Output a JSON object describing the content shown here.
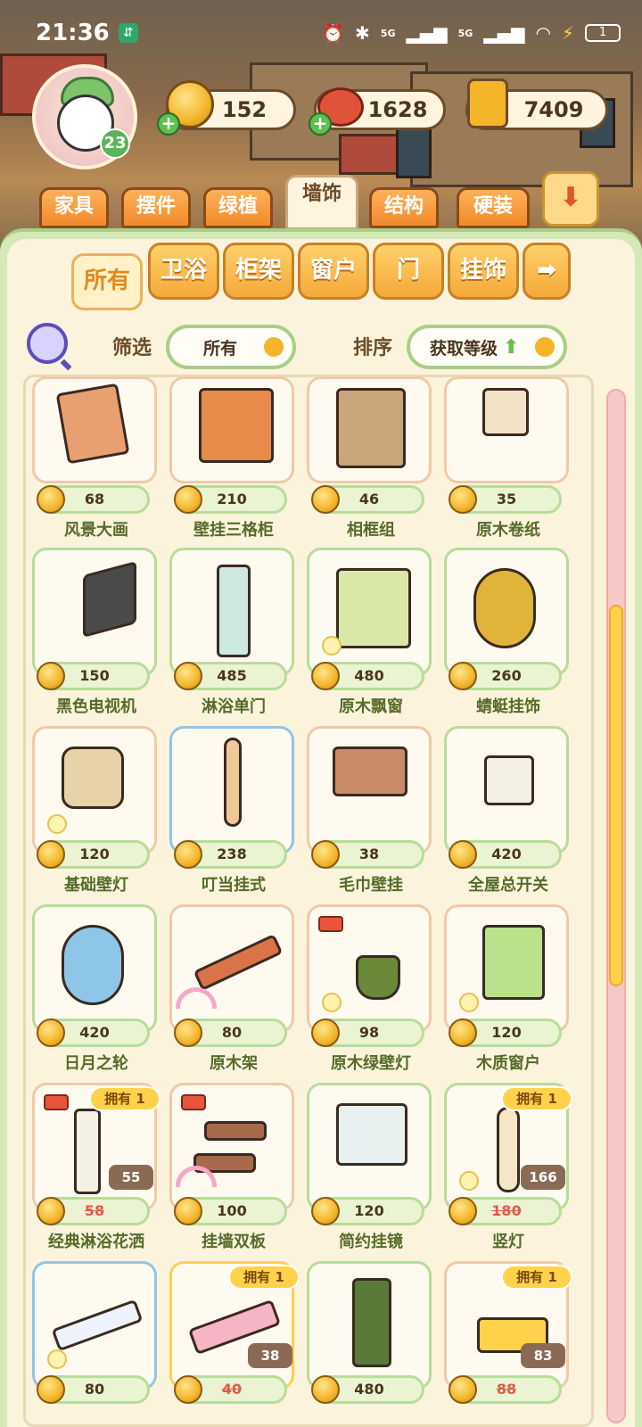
{
  "status_bar": {
    "time": "21:36",
    "app_badge": "⇵",
    "net_label": "5G",
    "battery_level": "1"
  },
  "hud": {
    "level": "23",
    "currencies": [
      {
        "icon": "gold-coin-icon",
        "value": "152"
      },
      {
        "icon": "cherry-icon",
        "value": "1628"
      },
      {
        "icon": "book-icon",
        "value": "7409"
      }
    ]
  },
  "categories": {
    "tabs": [
      "家具",
      "摆件",
      "绿植",
      "墙饰",
      "结构",
      "硬装"
    ],
    "active": "墙饰"
  },
  "subcategories": {
    "tabs": [
      "所有",
      "卫浴",
      "柜架",
      "窗户",
      "门",
      "挂饰"
    ],
    "next_arrow": "➡",
    "active": "所有"
  },
  "filter": {
    "filter_label": "筛选",
    "filter_value": "所有",
    "sort_label": "排序",
    "sort_value": "获取等级",
    "sort_dir": "⬆"
  },
  "items": [
    {
      "name": "风景大画",
      "price": "68"
    },
    {
      "name": "壁挂三格柜",
      "price": "210"
    },
    {
      "name": "相框组",
      "price": "46"
    },
    {
      "name": "原木卷纸",
      "price": "35"
    },
    {
      "name": "黑色电视机",
      "price": "150"
    },
    {
      "name": "淋浴单门",
      "price": "485"
    },
    {
      "name": "原木飘窗",
      "price": "480"
    },
    {
      "name": "蜻蜓挂饰",
      "price": "260"
    },
    {
      "name": "基础壁灯",
      "price": "120"
    },
    {
      "name": "叮当挂式",
      "price": "238"
    },
    {
      "name": "毛巾壁挂",
      "price": "38"
    },
    {
      "name": "全屋总开关",
      "price": "420"
    },
    {
      "name": "日月之轮",
      "price": "420"
    },
    {
      "name": "原木架",
      "price": "80"
    },
    {
      "name": "原木绿壁灯",
      "price": "98"
    },
    {
      "name": "木质窗户",
      "price": "120"
    },
    {
      "name": "经典淋浴花洒",
      "price": "58",
      "discount": "55",
      "owned": "拥有 1"
    },
    {
      "name": "挂墙双板",
      "price": "100"
    },
    {
      "name": "简约挂镜",
      "price": "120"
    },
    {
      "name": "竖灯",
      "price": "180",
      "discount": "166",
      "owned": "拥有 1"
    },
    {
      "name": "",
      "price": "80"
    },
    {
      "name": "",
      "price": "40",
      "discount": "38",
      "owned": "拥有 1"
    },
    {
      "name": "",
      "price": "480"
    },
    {
      "name": "",
      "price": "88",
      "discount": "83",
      "owned": "拥有 1"
    }
  ],
  "colors": {
    "panel_green": "#d5e9b8",
    "panel_cream": "#fbf3dc",
    "tab_orange": "#f08a2a",
    "name_green": "#556b2a",
    "coin_gold": "#f3b52a"
  }
}
